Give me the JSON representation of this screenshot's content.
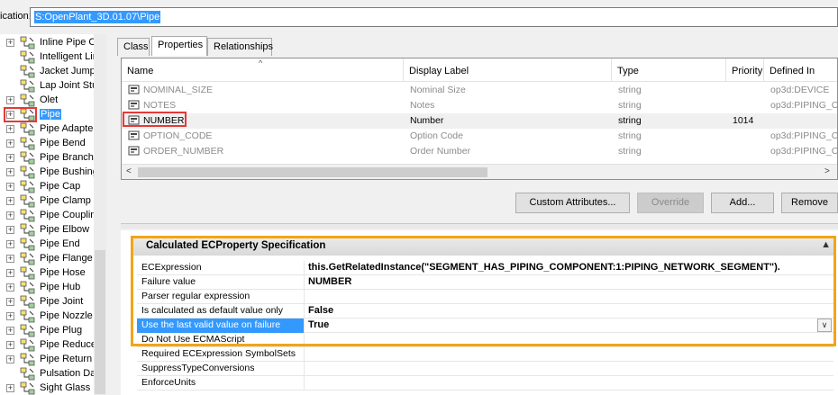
{
  "location": {
    "label": "ication:",
    "value": "S:OpenPlant_3D.01.07\\Pipe"
  },
  "tree": {
    "items": [
      {
        "label": "Inline Pipe C",
        "expander": "+",
        "selected": false
      },
      {
        "label": "Intelligent Lir",
        "expander": "",
        "selected": false
      },
      {
        "label": "Jacket Jump",
        "expander": "",
        "selected": false
      },
      {
        "label": "Lap Joint Stu",
        "expander": "",
        "selected": false
      },
      {
        "label": "Olet",
        "expander": "+",
        "selected": false
      },
      {
        "label": "Pipe",
        "expander": "+",
        "selected": true
      },
      {
        "label": "Pipe Adapte",
        "expander": "+",
        "selected": false
      },
      {
        "label": "Pipe Bend",
        "expander": "+",
        "selected": false
      },
      {
        "label": "Pipe Branch",
        "expander": "+",
        "selected": false
      },
      {
        "label": "Pipe Bushing",
        "expander": "+",
        "selected": false
      },
      {
        "label": "Pipe Cap",
        "expander": "+",
        "selected": false
      },
      {
        "label": "Pipe Clamp",
        "expander": "+",
        "selected": false
      },
      {
        "label": "Pipe Couplin",
        "expander": "+",
        "selected": false
      },
      {
        "label": "Pipe Elbow",
        "expander": "+",
        "selected": false
      },
      {
        "label": "Pipe End",
        "expander": "+",
        "selected": false
      },
      {
        "label": "Pipe Flange",
        "expander": "+",
        "selected": false
      },
      {
        "label": "Pipe Hose",
        "expander": "+",
        "selected": false
      },
      {
        "label": "Pipe Hub",
        "expander": "+",
        "selected": false
      },
      {
        "label": "Pipe Joint",
        "expander": "+",
        "selected": false
      },
      {
        "label": "Pipe Nozzle",
        "expander": "+",
        "selected": false
      },
      {
        "label": "Pipe Plug",
        "expander": "+",
        "selected": false
      },
      {
        "label": "Pipe Reduce",
        "expander": "+",
        "selected": false
      },
      {
        "label": "Pipe Return",
        "expander": "+",
        "selected": false
      },
      {
        "label": "Pulsation Da",
        "expander": "",
        "selected": false
      },
      {
        "label": "Sight Glass",
        "expander": "+",
        "selected": false
      }
    ]
  },
  "tabs": [
    {
      "label": "Class",
      "active": false
    },
    {
      "label": "Properties",
      "active": true
    },
    {
      "label": "Relationships",
      "active": false
    }
  ],
  "grid": {
    "columns": [
      "Name",
      "Display Label",
      "Type",
      "Priority",
      "Defined In"
    ],
    "rows": [
      {
        "name": "NOMINAL_SIZE",
        "display": "Nominal Size",
        "type": "string",
        "priority": "",
        "defined": "op3d:DEVICE"
      },
      {
        "name": "NOTES",
        "display": "Notes",
        "type": "string",
        "priority": "",
        "defined": "op3d:PIPING_C"
      },
      {
        "name": "NUMBER",
        "display": "Number",
        "type": "string",
        "priority": "1014",
        "defined": ""
      },
      {
        "name": "OPTION_CODE",
        "display": "Option Code",
        "type": "string",
        "priority": "",
        "defined": "op3d:PIPING_C"
      },
      {
        "name": "ORDER_NUMBER",
        "display": "Order Number",
        "type": "string",
        "priority": "",
        "defined": "op3d:PIPING_C"
      }
    ]
  },
  "buttons": {
    "custom_attributes": "Custom Attributes...",
    "override": "Override",
    "add": "Add...",
    "remove": "Remove"
  },
  "panel": {
    "title": "Calculated ECProperty Specification",
    "rows": [
      {
        "name": "ECExpression",
        "value": "this.GetRelatedInstance(\"SEGMENT_HAS_PIPING_COMPONENT:1:PIPING_NETWORK_SEGMENT\")."
      },
      {
        "name": "Failure value",
        "value": "NUMBER"
      },
      {
        "name": "Parser regular expression",
        "value": ""
      },
      {
        "name": "Is calculated as default value only",
        "value": "False"
      },
      {
        "name": "Use the last valid value on failure",
        "value": "True"
      },
      {
        "name": "Do Not Use ECMAScript",
        "value": ""
      },
      {
        "name": "Required ECExpression SymbolSets",
        "value": ""
      },
      {
        "name": "SuppressTypeConversions",
        "value": ""
      },
      {
        "name": "EnforceUnits",
        "value": ""
      }
    ]
  },
  "colors": {
    "selection": "#3399ff",
    "highlight_box": "#e53935",
    "panel_box": "#f2a516"
  }
}
